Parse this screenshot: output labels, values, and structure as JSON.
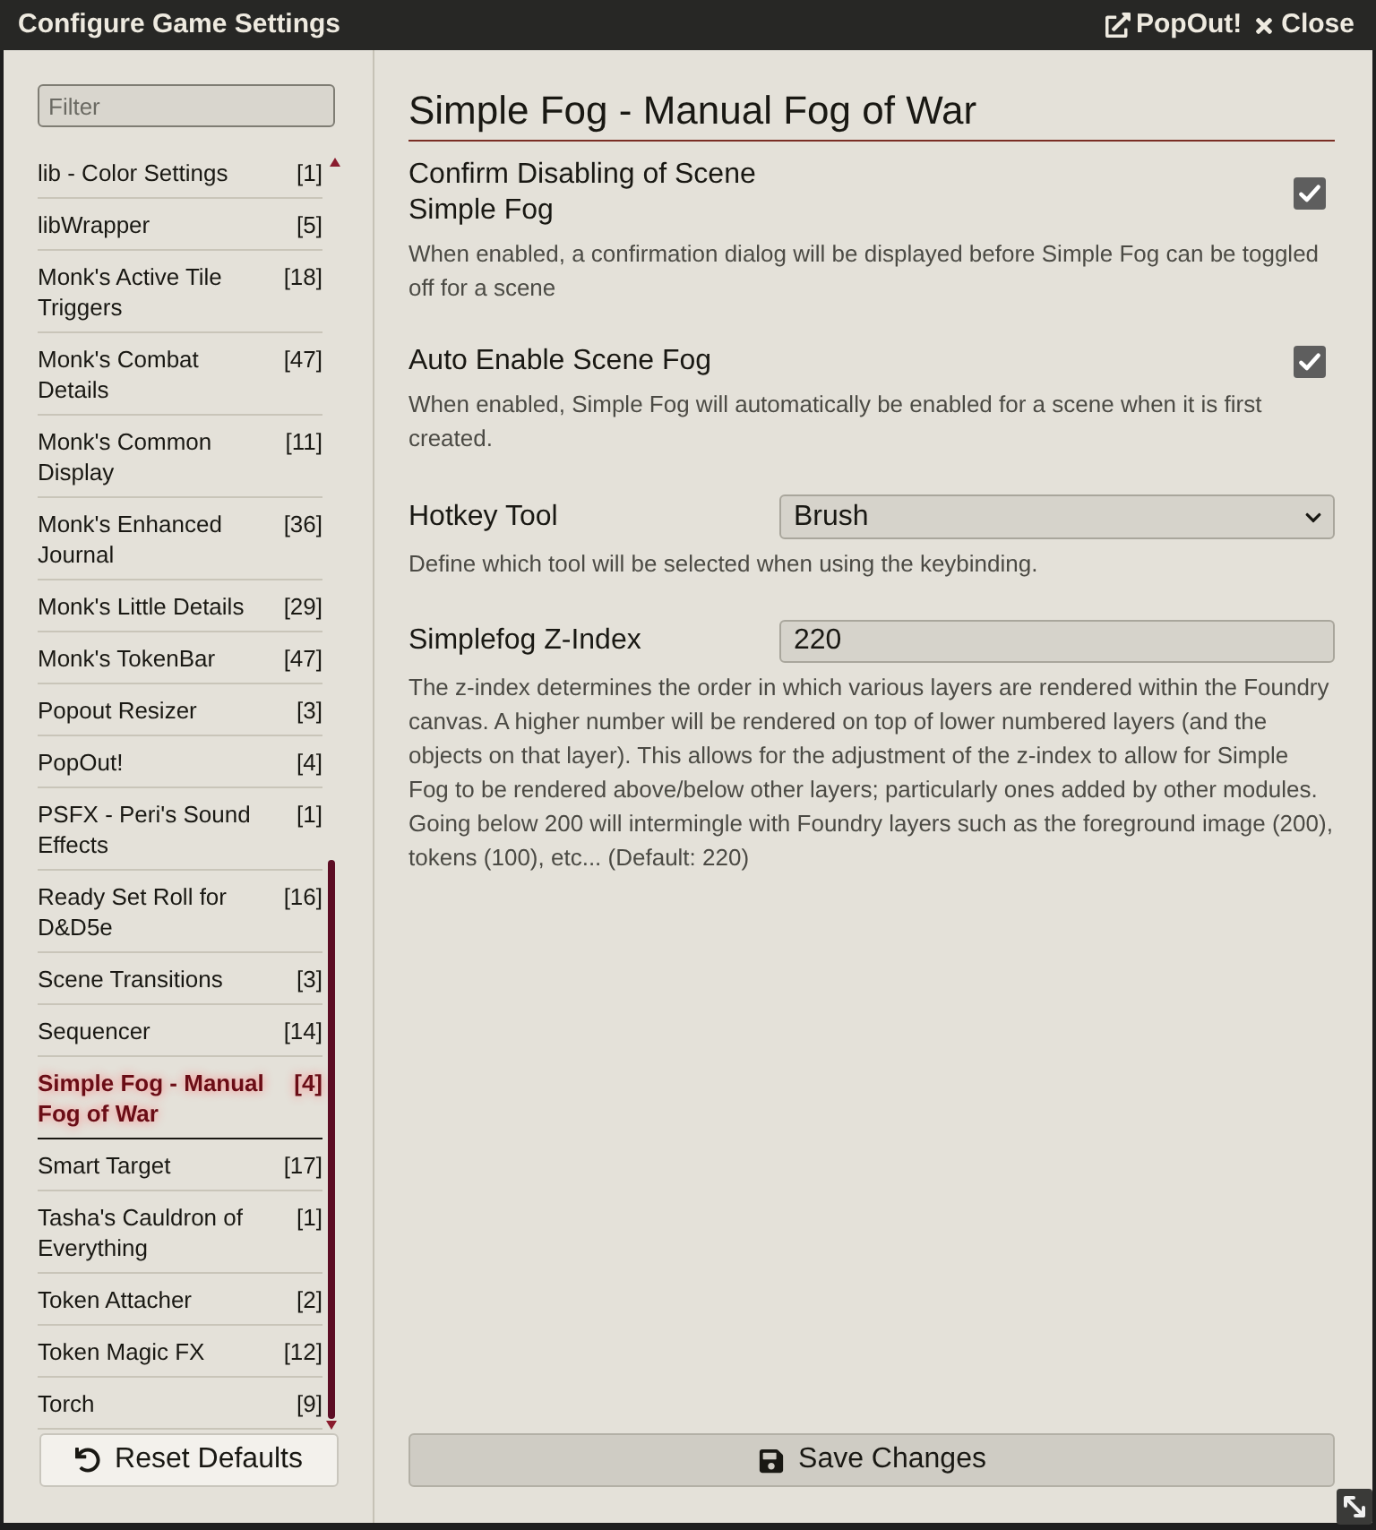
{
  "window": {
    "title": "Configure Game Settings",
    "header_buttons": [
      {
        "kind": "popout",
        "label": "PopOut!"
      },
      {
        "kind": "close",
        "label": "Close"
      }
    ]
  },
  "sidebar": {
    "filter": {
      "placeholder": "Filter"
    },
    "items": [
      {
        "name": "lib - Color Settings",
        "count": "[1]",
        "selected": false
      },
      {
        "name": "libWrapper",
        "count": "[5]",
        "selected": false
      },
      {
        "name": "Monk's Active Tile Triggers",
        "count": "[18]",
        "selected": false
      },
      {
        "name": "Monk's Combat Details",
        "count": "[47]",
        "selected": false
      },
      {
        "name": "Monk's Common Display",
        "count": "[11]",
        "selected": false
      },
      {
        "name": "Monk's Enhanced Journal",
        "count": "[36]",
        "selected": false
      },
      {
        "name": "Monk's Little Details",
        "count": "[29]",
        "selected": false
      },
      {
        "name": "Monk's TokenBar",
        "count": "[47]",
        "selected": false
      },
      {
        "name": "Popout Resizer",
        "count": "[3]",
        "selected": false
      },
      {
        "name": "PopOut!",
        "count": "[4]",
        "selected": false
      },
      {
        "name": "PSFX - Peri's Sound Effects",
        "count": "[1]",
        "selected": false
      },
      {
        "name": "Ready Set Roll for D&D5e",
        "count": "[16]",
        "selected": false
      },
      {
        "name": "Scene Transitions",
        "count": "[3]",
        "selected": false
      },
      {
        "name": "Sequencer",
        "count": "[14]",
        "selected": false
      },
      {
        "name": "Simple Fog - Manual Fog of War",
        "count": "[4]",
        "selected": true
      },
      {
        "name": "Smart Target",
        "count": "[17]",
        "selected": false
      },
      {
        "name": "Tasha's Cauldron of Everything",
        "count": "[1]",
        "selected": false
      },
      {
        "name": "Token Attacher",
        "count": "[2]",
        "selected": false
      },
      {
        "name": "Token Magic FX",
        "count": "[12]",
        "selected": false
      },
      {
        "name": "Torch",
        "count": "[9]",
        "selected": false
      }
    ],
    "reset_button": "Reset Defaults"
  },
  "main": {
    "title": "Simple Fog - Manual Fog of War",
    "settings": [
      {
        "kind": "checkbox",
        "label": "Confirm Disabling of Scene Simple Fog",
        "checked": true,
        "hint": "When enabled, a confirmation dialog will be displayed before Simple Fog can be toggled off for a scene"
      },
      {
        "kind": "checkbox",
        "label": "Auto Enable Scene Fog",
        "checked": true,
        "hint": "When enabled, Simple Fog will automatically be enabled for a scene when it is first created."
      },
      {
        "kind": "select",
        "label": "Hotkey Tool",
        "value": "Brush",
        "hint": "Define which tool will be selected when using the keybinding."
      },
      {
        "kind": "text",
        "label": "Simplefog Z-Index",
        "value": "220",
        "hint": "The z-index determines the order in which various layers are rendered within the Foundry canvas. A higher number will be rendered on top of lower numbered layers (and the objects on that layer). This allows for the adjustment of the z-index to allow for Simple Fog to be rendered above/below other layers; particularly ones added by other modules. Going below 200 will intermingle with Foundry layers such as the foreground image (200), tokens (100), etc... (Default: 220)"
      }
    ],
    "save_button": "Save Changes"
  }
}
